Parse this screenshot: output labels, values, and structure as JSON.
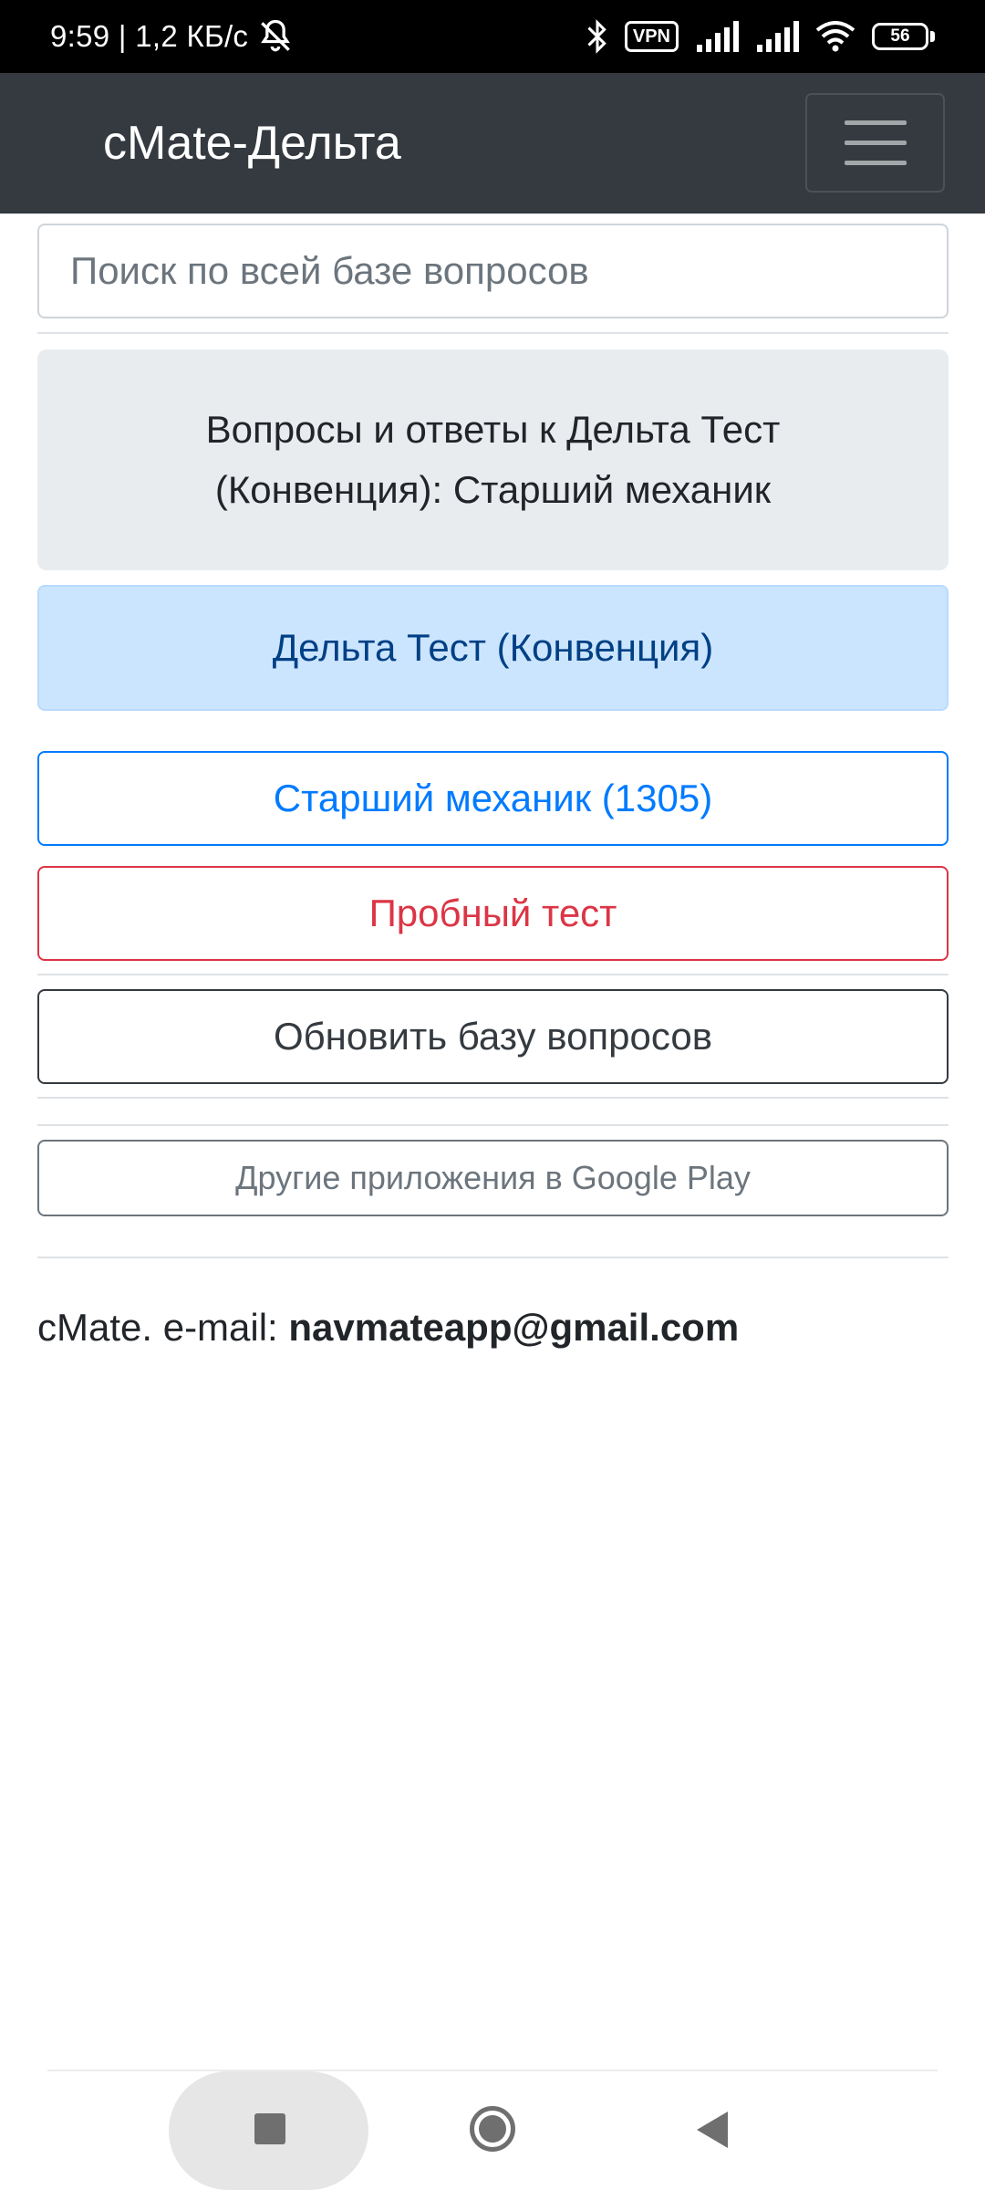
{
  "status_bar": {
    "left_text": "9:59 | 1,2 КБ/с",
    "vpn_label": "VPN",
    "battery_level": "56",
    "icons": [
      "bell-muted-icon",
      "bluetooth-icon",
      "vpn-icon",
      "signal-icon",
      "signal-icon",
      "wifi-icon",
      "battery-icon"
    ]
  },
  "navbar": {
    "brand": "cMate-Дельта",
    "menu_icon": "hamburger-menu-icon"
  },
  "search": {
    "placeholder": "Поиск по всей базе вопросов",
    "value": ""
  },
  "jumbotron": {
    "text": "Вопросы и ответы к Дельта Тест (Конвенция): Старший механик"
  },
  "alert": {
    "text": "Дельта Тест (Конвенция)"
  },
  "buttons": {
    "category": "Старший механик (1305)",
    "trial_test": "Пробный тест",
    "update_db": "Обновить базу вопросов",
    "other_apps": "Другие приложения в Google Play"
  },
  "footer": {
    "prefix": "cMate. e-mail: ",
    "email": "navmateapp@gmail.com"
  },
  "colors": {
    "navbar_bg": "#343a40",
    "primary": "#007bff",
    "danger": "#dc3545",
    "alert_bg": "#cce5ff",
    "jumbotron_bg": "#e9ecef"
  }
}
